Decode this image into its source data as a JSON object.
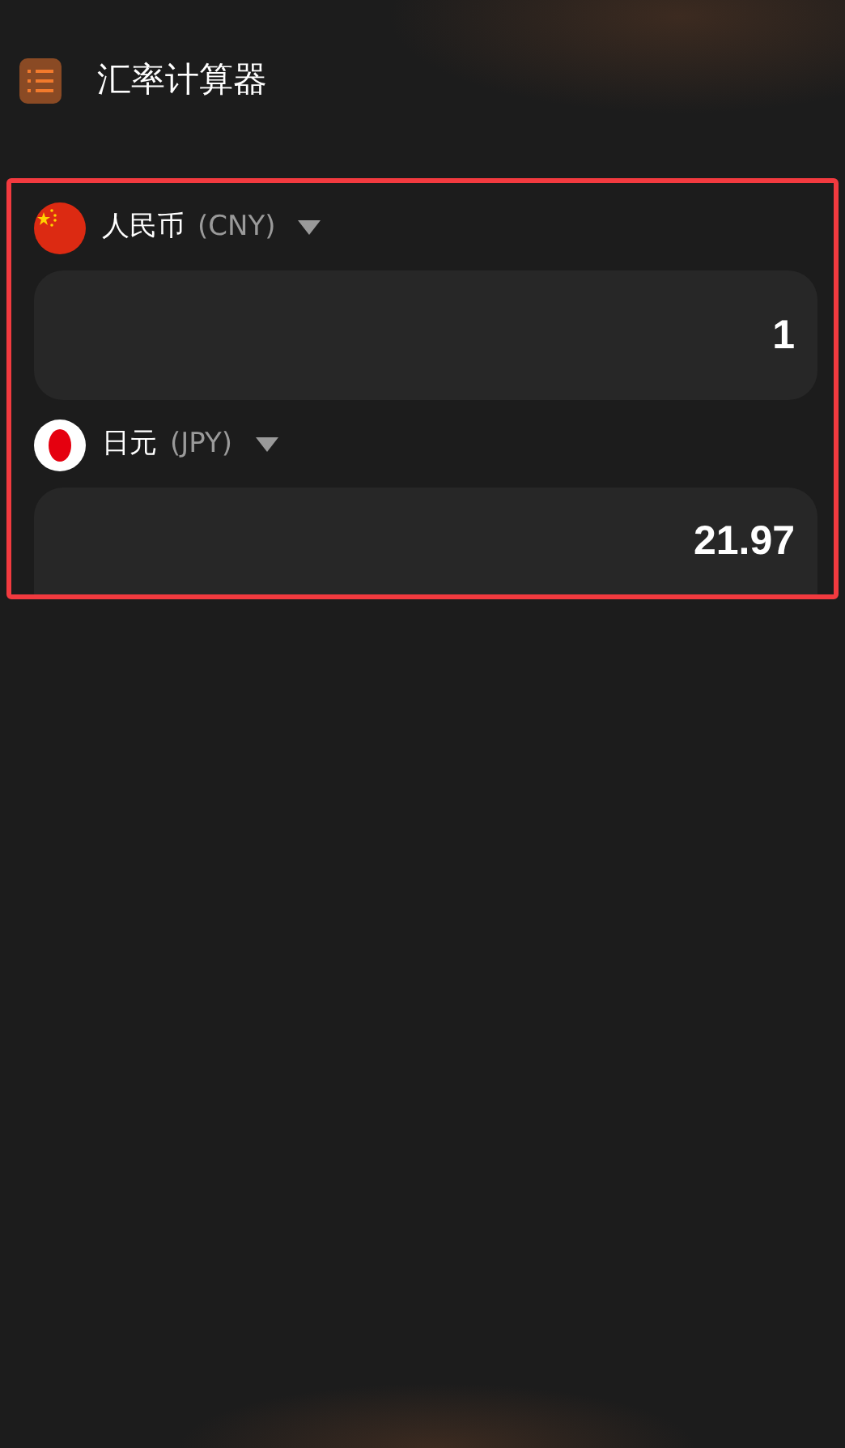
{
  "app_bar": {
    "title": "汇率计算器"
  },
  "currencies": [
    {
      "kind": "cn",
      "name": "人民币",
      "code": "(CNY)",
      "value": "1"
    },
    {
      "kind": "jp",
      "name": "日元",
      "code": "(JPY)",
      "value": "21.97"
    }
  ]
}
